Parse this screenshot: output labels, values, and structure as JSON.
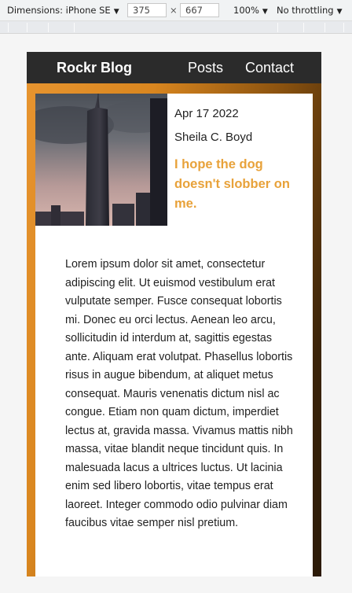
{
  "devtools": {
    "device_label": "Dimensions: iPhone SE",
    "width": "375",
    "times": "×",
    "height": "667",
    "zoom": "100%",
    "throttle": "No throttling"
  },
  "nav": {
    "brand": "Rockr Blog",
    "links": [
      "Posts",
      "Contact"
    ]
  },
  "post": {
    "date": "Apr 17 2022",
    "author": "Sheila C. Boyd",
    "title": "I hope the dog doesn't slobber on me.",
    "body": "Lorem ipsum dolor sit amet, consectetur adipiscing elit. Ut euismod vestibulum erat vulputate semper. Fusce consequat lobortis mi. Donec eu orci lectus. Aenean leo arcu, sollicitudin id interdum at, sagittis egestas ante. Aliquam erat volutpat. Phasellus lobortis risus in augue bibendum, at aliquet metus consequat. Mauris venenatis dictum nisl ac congue. Etiam non quam dictum, imperdiet lectus at, gravida massa. Vivamus mattis nibh massa, vitae blandit neque tincidunt quis. In malesuada lacus a ultrices luctus. Ut lacinia enim sed libero lobortis, vitae tempus erat laoreet. Integer commodo odio pulvinar diam faucibus vitae semper nisl pretium."
  },
  "colors": {
    "nav_bg": "#2b2b2b",
    "accent": "#e8a23a",
    "hero_gradient_start": "#e7942f",
    "hero_gradient_end": "#2b1a08"
  }
}
